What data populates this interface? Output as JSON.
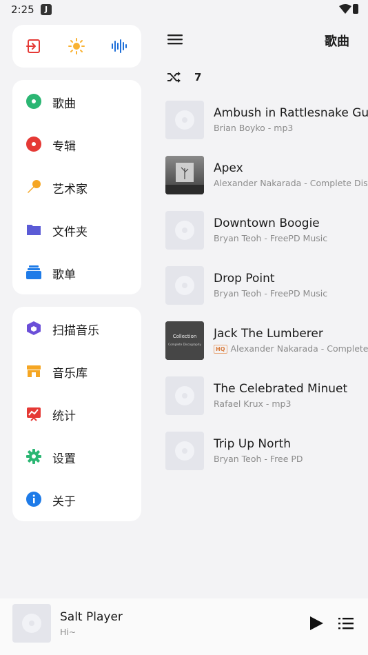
{
  "status": {
    "time": "2:25",
    "app_badge": "J"
  },
  "quick_actions": [
    {
      "icon": "exit-icon",
      "color": "#e53935"
    },
    {
      "icon": "sun-icon",
      "color": "#f9b233"
    },
    {
      "icon": "waveform-icon",
      "color": "#1e6fd9"
    }
  ],
  "nav_primary": [
    {
      "label": "歌曲",
      "icon": "song-disc-icon",
      "color": "#2bb673"
    },
    {
      "label": "专辑",
      "icon": "album-disc-icon",
      "color": "#e53935"
    },
    {
      "label": "艺术家",
      "icon": "microphone-icon",
      "color": "#f5a623"
    },
    {
      "label": "文件夹",
      "icon": "folder-icon",
      "color": "#5b5bd6"
    },
    {
      "label": "歌单",
      "icon": "playlist-stack-icon",
      "color": "#1e7be8"
    }
  ],
  "nav_secondary": [
    {
      "label": "扫描音乐",
      "icon": "scan-cube-icon",
      "color": "#6b4fd8"
    },
    {
      "label": "音乐库",
      "icon": "store-icon",
      "color": "#f5a623"
    },
    {
      "label": "统计",
      "icon": "stats-icon",
      "color": "#e53935"
    },
    {
      "label": "设置",
      "icon": "gear-icon",
      "color": "#2bb673"
    },
    {
      "label": "关于",
      "icon": "info-icon",
      "color": "#1e7be8"
    }
  ],
  "header": {
    "title": "歌曲"
  },
  "shuffle": {
    "count": "7"
  },
  "songs": [
    {
      "title": "Ambush in Rattlesnake Gulch",
      "subtitle": "Brian Boyko - mp3",
      "hq": "",
      "cover": "placeholder"
    },
    {
      "title": "Apex",
      "subtitle": "Alexander Nakarada - Complete Discography",
      "hq": "",
      "cover": "apex-art"
    },
    {
      "title": "Downtown Boogie",
      "subtitle": "Bryan Teoh - FreePD Music",
      "hq": "",
      "cover": "placeholder"
    },
    {
      "title": "Drop Point",
      "subtitle": "Bryan Teoh - FreePD Music",
      "hq": "",
      "cover": "placeholder"
    },
    {
      "title": "Jack The Lumberer",
      "subtitle": "Alexander Nakarada - Complete Discography",
      "hq": "HQ",
      "cover": "collection-art"
    },
    {
      "title": "The Celebrated Minuet",
      "subtitle": "Rafael Krux - mp3",
      "hq": "",
      "cover": "placeholder"
    },
    {
      "title": "Trip Up North",
      "subtitle": "Bryan Teoh - Free PD",
      "hq": "",
      "cover": "placeholder"
    }
  ],
  "cover_art": {
    "collection_line1": "Collection",
    "collection_line2": "Complete Discography"
  },
  "player": {
    "title": "Salt Player",
    "subtitle": "Hi~"
  }
}
